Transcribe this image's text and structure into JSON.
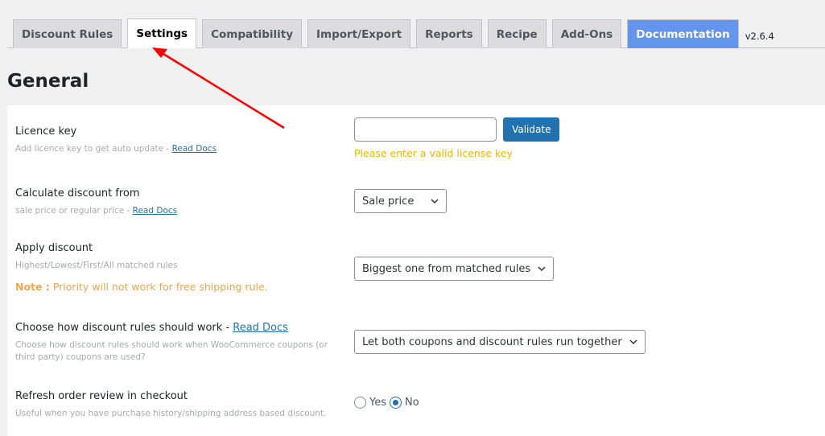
{
  "tabs": [
    {
      "label": "Discount Rules",
      "active": false
    },
    {
      "label": "Settings",
      "active": true
    },
    {
      "label": "Compatibility",
      "active": false
    },
    {
      "label": "Import/Export",
      "active": false
    },
    {
      "label": "Reports",
      "active": false
    },
    {
      "label": "Recipe",
      "active": false
    },
    {
      "label": "Add-Ons",
      "active": false
    },
    {
      "label": "Documentation",
      "active": false
    }
  ],
  "version": "v2.6.4",
  "section_title": "General",
  "settings": {
    "licence": {
      "title": "Licence key",
      "desc": "Add licence key to get auto update - ",
      "link": "Read Docs",
      "input_value": "",
      "button": "Validate",
      "warning": "Please enter a valid license key"
    },
    "calculate": {
      "title": "Calculate discount from",
      "desc": "sale price or regular price - ",
      "link": "Read Docs",
      "selected": "Sale price"
    },
    "apply": {
      "title": "Apply discount",
      "desc": "Highest/Lowest/First/All matched rules",
      "note_label": "Note :",
      "note_text": " Priority will not work for free shipping rule.",
      "selected": "Biggest one from matched rules"
    },
    "coupon_behavior": {
      "title": "Choose how discount rules should work - ",
      "link": "Read Docs",
      "desc": "Choose how discount rules should work when WooCommerce coupons (or third party) coupons are used?",
      "selected": "Let both coupons and discount rules run together"
    },
    "refresh": {
      "title": "Refresh order review in checkout",
      "desc": "Useful when you have purchase history/shipping address based discount.",
      "options": [
        "Yes",
        "No"
      ],
      "selected": "No"
    }
  },
  "colors": {
    "primary": "#2271b1",
    "documentation_tab": "#6495ed",
    "warning": "#f0b400",
    "note": "#f0a54b",
    "annotation_arrow": "#ff0000"
  }
}
